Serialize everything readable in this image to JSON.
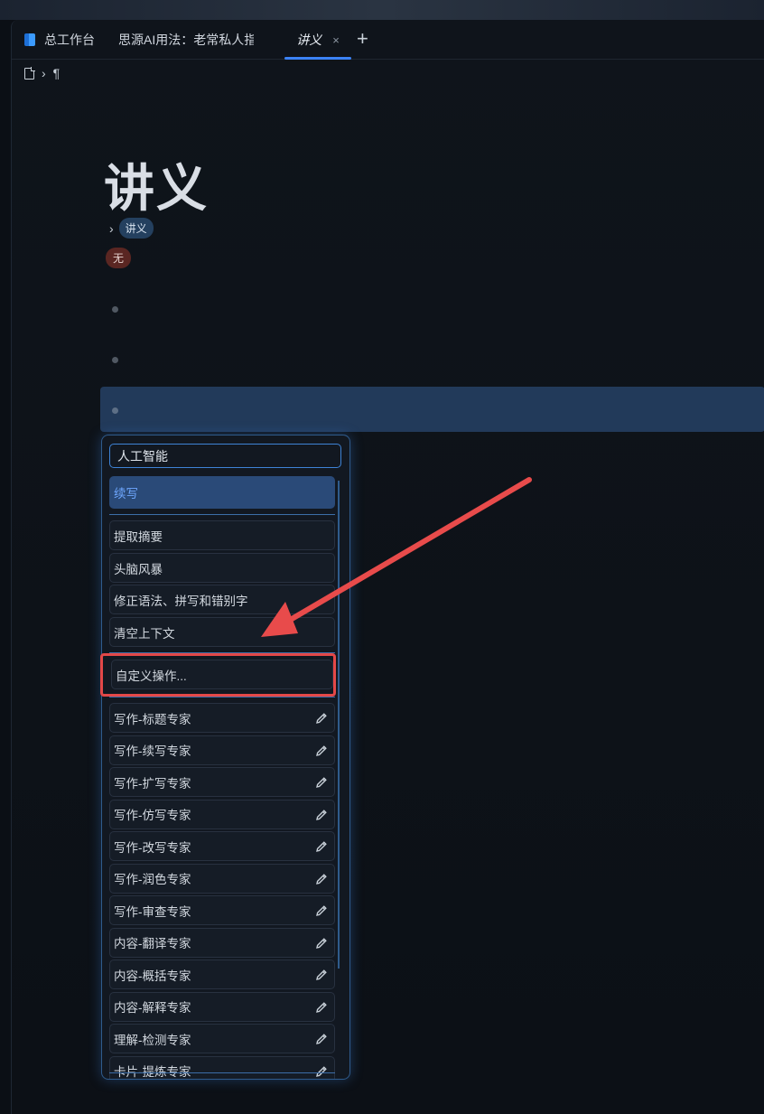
{
  "tabs": [
    {
      "label": "总工作台"
    },
    {
      "label": "思源AI用法：老常私人指"
    },
    {
      "label": "讲义",
      "close": "×"
    }
  ],
  "tab_add": "+",
  "breadcrumb": {
    "separator": "›",
    "pilcrow": "¶"
  },
  "document": {
    "title": "讲义",
    "tag": "讲义",
    "badge": "无",
    "chevron": "›"
  },
  "menu": {
    "search_value": "人工智能",
    "items_top": [
      "续写"
    ],
    "items_mid": [
      "提取摘要",
      "头脑风暴",
      "修正语法、拼写和错别字",
      "清空上下文"
    ],
    "custom": "自定义操作...",
    "presets": [
      "写作-标题专家",
      "写作-续写专家",
      "写作-扩写专家",
      "写作-仿写专家",
      "写作-改写专家",
      "写作-润色专家",
      "写作-审查专家",
      "内容-翻译专家",
      "内容-概括专家",
      "内容-解释专家",
      "理解-检测专家",
      "卡片-提炼专家"
    ]
  },
  "colors": {
    "accent": "#3b82f6",
    "highlight": "#e34848",
    "arrow": "#e84b4b"
  }
}
